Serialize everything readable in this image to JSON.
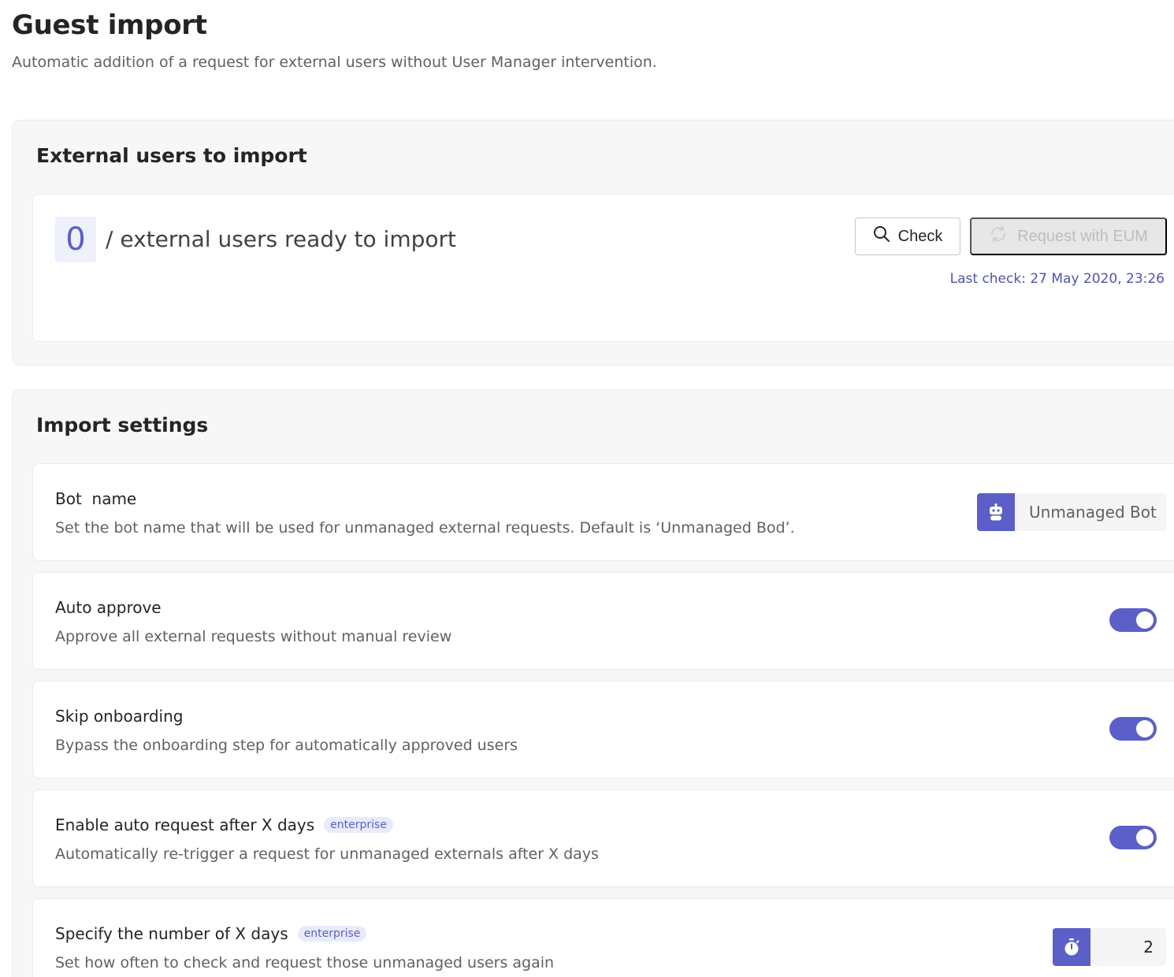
{
  "header": {
    "title": "Guest import",
    "subtitle": "Automatic addition of a request for external users without User Manager intervention."
  },
  "external_users": {
    "section_title": "External users to import",
    "count": "0",
    "ready_text": "/ external users ready to import",
    "check_button": "Check",
    "request_button": "Request with EUM",
    "last_check": "Last check: 27 May 2020, 23:26"
  },
  "import_settings": {
    "section_title": "Import settings",
    "bot_name": {
      "title": "Bot  name",
      "description": "Set the bot name that will be used for unmanaged external requests. Default is ‘Unmanaged Bod’.",
      "value": "Unmanaged Bot",
      "icon": "bot-icon"
    },
    "auto_approve": {
      "title": "Auto approve",
      "description": "Approve all external requests without manual review",
      "enabled": true
    },
    "skip_onboarding": {
      "title": "Skip onboarding",
      "description": "Bypass the onboarding step for automatically approved users",
      "enabled": true
    },
    "auto_request": {
      "title": "Enable auto request after X days",
      "badge": "enterprise",
      "description": "Automatically re-trigger a request for unmanaged externals after X days",
      "enabled": true
    },
    "x_days": {
      "title": "Specify the number of X days",
      "badge": "enterprise",
      "description": "Set how often to check and request those unmanaged users again",
      "value": "2",
      "icon": "timer-icon"
    }
  },
  "colors": {
    "accent": "#5b5fc7",
    "link": "#4f52b2",
    "badge_bg": "#e8ebfa"
  }
}
